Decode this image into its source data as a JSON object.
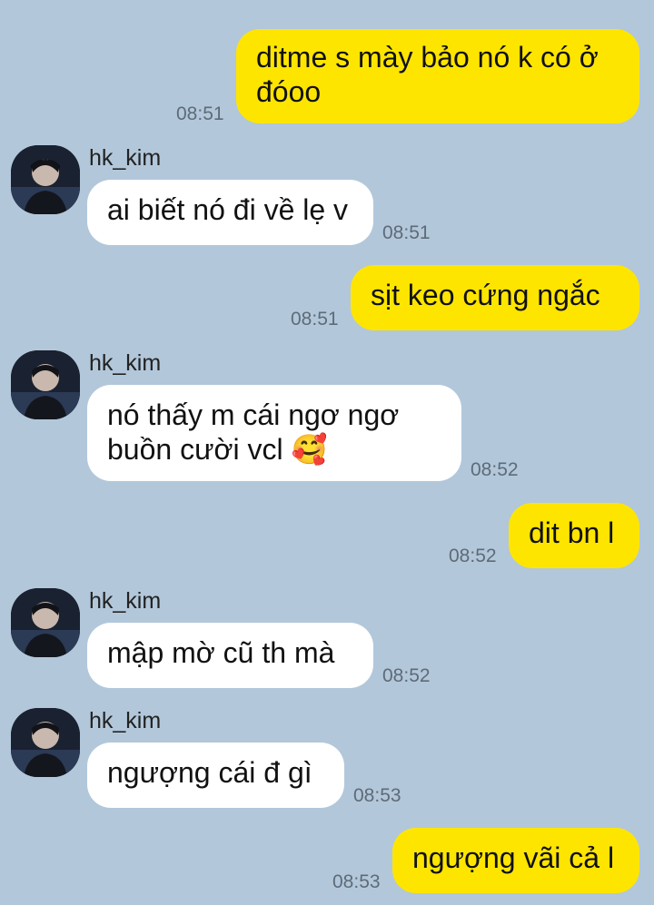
{
  "conversation": {
    "messages": [
      {
        "sender": "me",
        "text": "ditme s mày bảo nó k có ở đóoo",
        "time": "08:51"
      },
      {
        "sender": "them",
        "name": "hk_kim",
        "text": "ai biết nó đi về lẹ v",
        "time": "08:51"
      },
      {
        "sender": "me",
        "text": "sịt keo cứng ngắc",
        "time": "08:51"
      },
      {
        "sender": "them",
        "name": "hk_kim",
        "text": "nó thấy m cái ngơ ngơ buồn cười vcl 🥰",
        "time": "08:52"
      },
      {
        "sender": "me",
        "text": "dit bn l",
        "time": "08:52"
      },
      {
        "sender": "them",
        "name": "hk_kim",
        "text": "mập mờ cũ th mà",
        "time": "08:52"
      },
      {
        "sender": "them",
        "name": "hk_kim",
        "text": "ngượng cái đ gì",
        "time": "08:53"
      },
      {
        "sender": "me",
        "text": "ngượng vãi cả l",
        "time": "08:53"
      }
    ]
  },
  "colors": {
    "background": "#b2c7da",
    "my_bubble": "#fee500",
    "their_bubble": "#ffffff"
  },
  "icons": {
    "avatar": "profile-avatar-icon",
    "emoji": "smiling-face-with-hearts"
  }
}
